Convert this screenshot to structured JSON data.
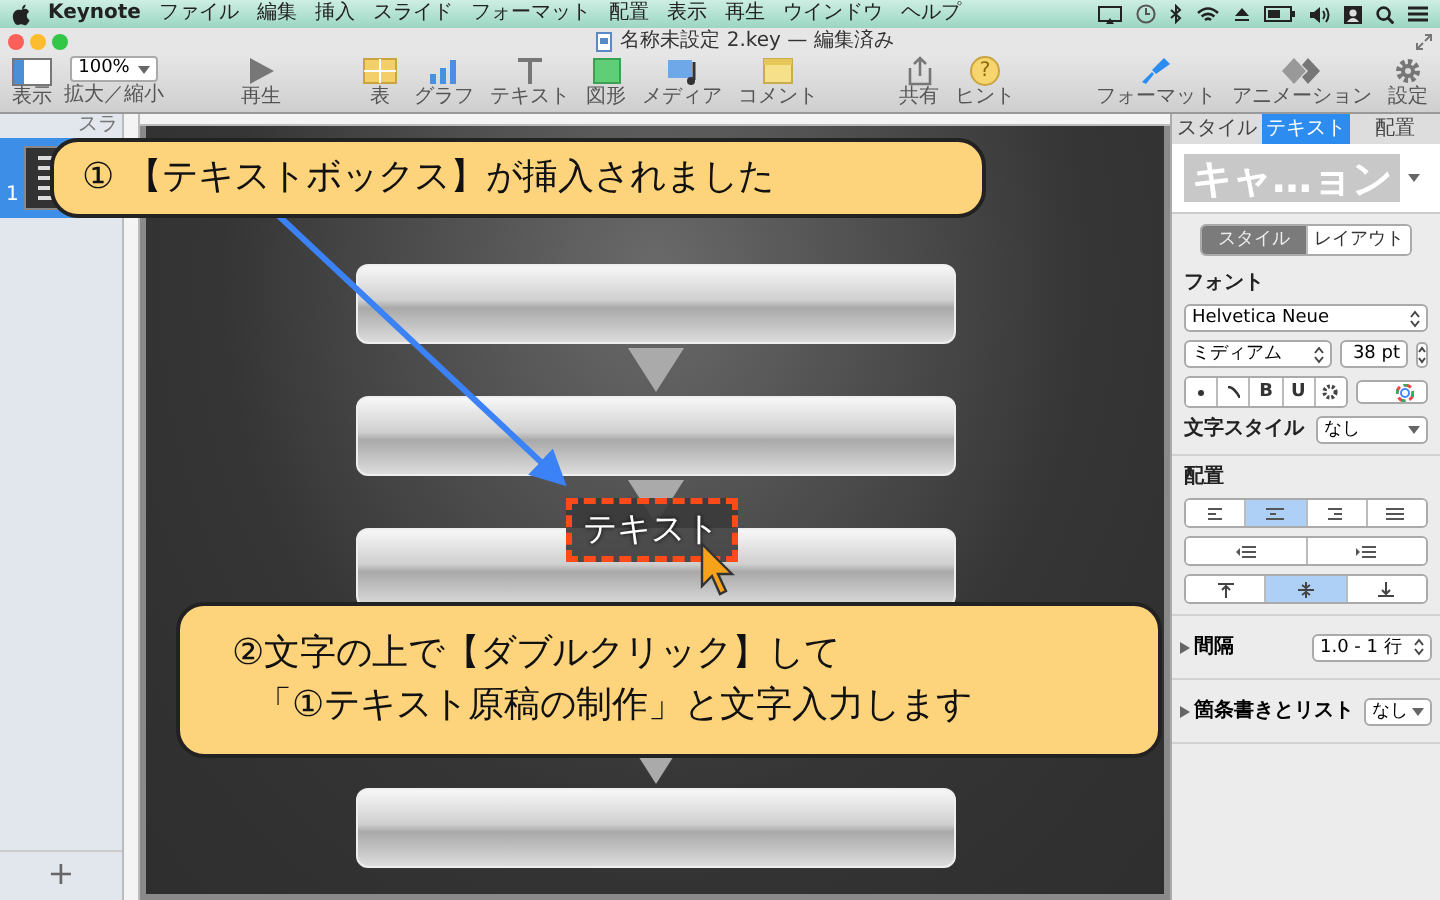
{
  "menubar": {
    "app": "Keynote",
    "menus": [
      "ファイル",
      "編集",
      "挿入",
      "スライド",
      "フォーマット",
      "配置",
      "表示",
      "再生",
      "ウインドウ",
      "ヘルプ"
    ]
  },
  "window": {
    "title": "名称未設定 2.key — 編集済み"
  },
  "toolbar": {
    "groups": [
      [
        {
          "kind": "view",
          "label": "表示"
        },
        {
          "kind": "zoom",
          "value": "100%",
          "label": "拡大／縮小"
        }
      ],
      [
        {
          "kind": "play",
          "label": "再生"
        }
      ],
      [
        {
          "kind": "table",
          "label": "表"
        },
        {
          "kind": "chart",
          "label": "グラフ"
        },
        {
          "kind": "text",
          "label": "テキスト"
        },
        {
          "kind": "shape",
          "label": "図形"
        },
        {
          "kind": "media",
          "label": "メディア"
        },
        {
          "kind": "comment",
          "label": "コメント"
        }
      ],
      [
        {
          "kind": "share",
          "label": "共有"
        },
        {
          "kind": "hint",
          "glyph": "?",
          "label": "ヒント"
        }
      ],
      [
        {
          "kind": "format",
          "label": "フォーマット"
        },
        {
          "kind": "animation",
          "label": "アニメーション"
        },
        {
          "kind": "settings",
          "label": "設定"
        }
      ]
    ]
  },
  "sidebar": {
    "title": "スラ",
    "slides": [
      {
        "number": "1",
        "selected": true
      }
    ],
    "add": "+"
  },
  "slide": {
    "text_box": "テキスト"
  },
  "callouts": [
    {
      "lines": [
        "① 【テキストボックス】が挿入されました"
      ]
    },
    {
      "lines": [
        "②文字の上で【ダブルクリック】して",
        "「①テキスト原稿の制作」と文字入力します"
      ]
    }
  ],
  "inspector": {
    "tabs": [
      {
        "label": "スタイル",
        "selected": false
      },
      {
        "label": "テキスト",
        "selected": true
      },
      {
        "label": "配置",
        "selected": false
      }
    ],
    "preview": "キャ…ョン",
    "segments": [
      {
        "label": "スタイル",
        "selected": true
      },
      {
        "label": "レイアウト",
        "selected": false
      }
    ],
    "font_label": "フォント",
    "font": "Helvetica Neue",
    "weight": "ミディアム",
    "size": "38 pt",
    "style_buttons": [
      {
        "kind": "dot"
      },
      {
        "kind": "slash"
      },
      {
        "kind": "label",
        "label": "B"
      },
      {
        "kind": "label",
        "label": "U"
      },
      {
        "kind": "gear"
      }
    ],
    "char_style": {
      "label": "文字スタイル",
      "value": "なし"
    },
    "alignment": {
      "label": "配置",
      "horizontal": [
        {
          "selected": false
        },
        {
          "selected": true
        },
        {
          "selected": false
        },
        {
          "selected": false
        }
      ],
      "vertical": [
        {
          "selected": false
        },
        {
          "selected": true
        },
        {
          "selected": false
        }
      ]
    },
    "spacing": {
      "label": "間隔",
      "value": "1.0 - 1 行",
      "expanded": false
    },
    "bullets": {
      "label": "箇条書きとリスト",
      "value": "なし",
      "expanded": false
    }
  }
}
